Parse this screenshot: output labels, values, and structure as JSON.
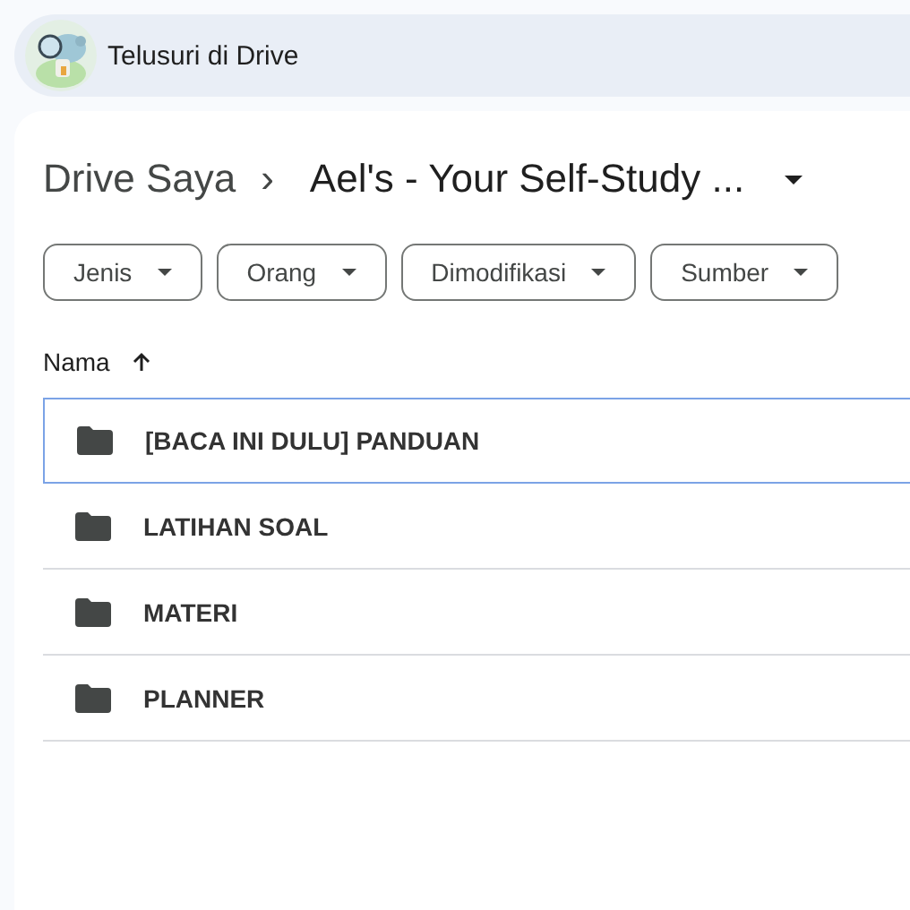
{
  "search": {
    "placeholder": "Telusuri di Drive"
  },
  "breadcrumb": {
    "root": "Drive Saya",
    "separator": "›",
    "current": "Ael's - Your Self-Study ..."
  },
  "filters": [
    {
      "label": "Jenis"
    },
    {
      "label": "Orang"
    },
    {
      "label": "Dimodifikasi"
    },
    {
      "label": "Sumber"
    }
  ],
  "table": {
    "columns": [
      {
        "label": "Nama",
        "sort_ascending": true
      }
    ],
    "rows": [
      {
        "name": "[BACA INI DULU] PANDUAN",
        "selected": true
      },
      {
        "name": "LATIHAN SOAL",
        "selected": false
      },
      {
        "name": "MATERI",
        "selected": false
      },
      {
        "name": "PLANNER",
        "selected": false
      }
    ]
  }
}
